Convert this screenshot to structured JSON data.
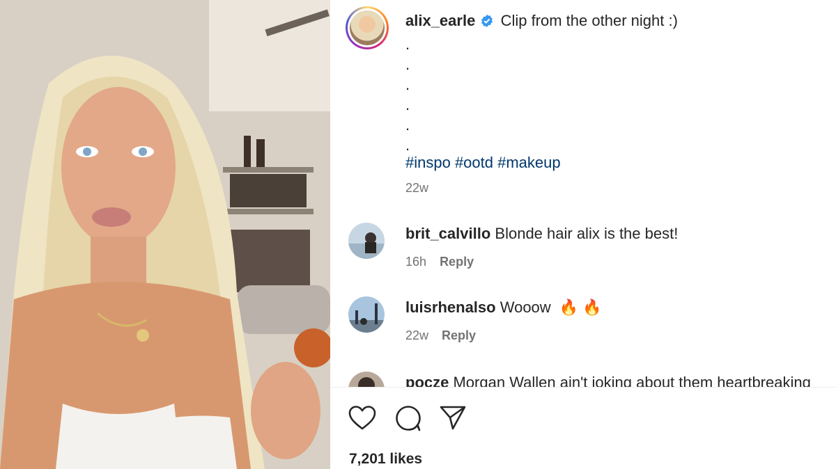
{
  "post": {
    "username": "alix_earle",
    "caption": "Clip from the other night :)",
    "dots": [
      ".",
      ".",
      ".",
      ".",
      ".",
      "."
    ],
    "hashtags": "#inspo #ootd #makeup",
    "time": "22w"
  },
  "comments": [
    {
      "username": "brit_calvillo",
      "text": "Blonde hair alix is the best!",
      "time": "16h",
      "reply": "Reply"
    },
    {
      "username": "luisrhenalso",
      "text": "Wooow",
      "emoji": "🔥 🔥",
      "time": "22w",
      "reply": "Reply"
    },
    {
      "username": "pocze",
      "text": "Morgan Wallen ain't joking about them heartbreaking"
    }
  ],
  "actions": {
    "like_icon": "heart-icon",
    "comment_icon": "comment-icon",
    "share_icon": "paper-plane-icon"
  },
  "likes": "7,201 likes",
  "colors": {
    "verified": "#3897f0",
    "hashtag": "#00376b",
    "meta": "#737373"
  }
}
